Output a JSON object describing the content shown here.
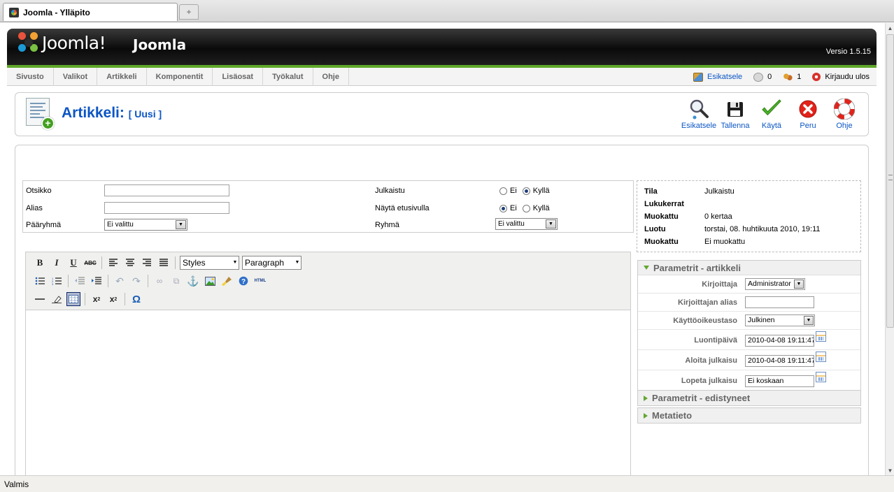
{
  "browser": {
    "tab_title": "Joomla - Ylläpito",
    "new_tab": "+",
    "status": "Valmis"
  },
  "header": {
    "logo_text": "Joomla!",
    "site_name": "Joomla",
    "version": "Versio 1.5.15"
  },
  "menu": {
    "items": [
      {
        "label": "Sivusto"
      },
      {
        "label": "Valikot"
      },
      {
        "label": "Artikkeli"
      },
      {
        "label": "Komponentit"
      },
      {
        "label": "Lisäosat"
      },
      {
        "label": "Työkalut"
      },
      {
        "label": "Ohje"
      }
    ],
    "preview": "Esikatsele",
    "messages_count": "0",
    "users_count": "1",
    "logout": "Kirjaudu ulos"
  },
  "toolbar": {
    "title": "Artikkeli:",
    "subtitle": "[ Uusi ]",
    "buttons": {
      "preview": "Esikatsele",
      "save": "Tallenna",
      "apply": "Käytä",
      "cancel": "Peru",
      "help": "Ohje"
    }
  },
  "form": {
    "title_label": "Otsikko",
    "title_value": "",
    "alias_label": "Alias",
    "alias_value": "",
    "section_label": "Pääryhmä",
    "section_value": "Ei valittu",
    "published_label": "Julkaistu",
    "frontpage_label": "Näytä etusivulla",
    "category_label": "Ryhmä",
    "category_value": "Ei valittu",
    "no": "Ei",
    "yes": "Kyllä",
    "published": "yes",
    "frontpage": "no"
  },
  "editor": {
    "styles": "Styles",
    "format": "Paragraph",
    "html_label": "HTML",
    "omega": "Ω"
  },
  "info": {
    "rows": [
      {
        "key": "Tila",
        "value": "Julkaistu"
      },
      {
        "key": "Lukukerrat",
        "value": ""
      },
      {
        "key": "Muokattu",
        "value": "0 kertaa"
      },
      {
        "key": "Luotu",
        "value": "torstai, 08. huhtikuuta 2010, 19:11"
      },
      {
        "key": "Muokattu",
        "value": "Ei muokattu"
      }
    ]
  },
  "params": {
    "article_title": "Parametrit - artikkeli",
    "author_label": "Kirjoittaja",
    "author_value": "Administrator",
    "author_alias_label": "Kirjoittajan alias",
    "author_alias_value": "",
    "access_label": "Käyttöoikeustaso",
    "access_value": "Julkinen",
    "created_label": "Luontipäivä",
    "created_value": "2010-04-08 19:11:47",
    "publish_up_label": "Aloita julkaisu",
    "publish_up_value": "2010-04-08 19:11:47",
    "publish_down_label": "Lopeta julkaisu",
    "publish_down_value": "Ei koskaan",
    "advanced_title": "Parametrit - edistyneet",
    "meta_title": "Metatieto"
  }
}
